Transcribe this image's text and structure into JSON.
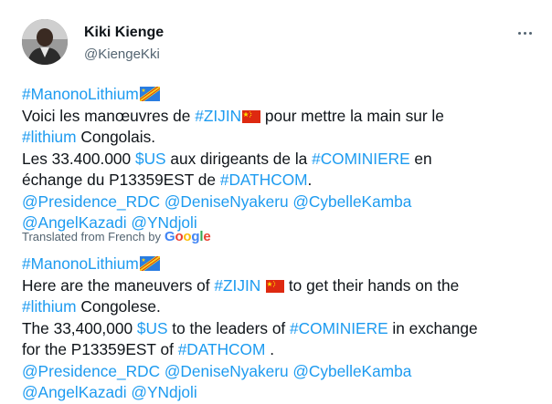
{
  "author": {
    "name": "Kiki Kienge",
    "handle": "@KiengeKki"
  },
  "original": {
    "line1": {
      "hashtag": "#ManonoLithium"
    },
    "line2": {
      "pre": "Voici les manœuvres de ",
      "hashtag": "#ZIJIN",
      "post": " pour mettre la main sur le"
    },
    "line3": {
      "hashtag": "#lithium",
      "post": " Congolais."
    },
    "line4": {
      "pre": "Les 33.400.000 ",
      "cashtag": "$US",
      "mid": " aux dirigeants de la ",
      "hashtag": "#COMINIERE",
      "post": " en"
    },
    "line5": {
      "pre": "échange du P13359EST de ",
      "hashtag": "#DATHCOM",
      "post": "."
    },
    "line6": {
      "m1": "@Presidence_RDC",
      "m2": "@DeniseNyakeru",
      "m3": "@CybelleKamba"
    },
    "line7": {
      "m1": "@AngelKazadi",
      "m2": "@YNdjoli"
    }
  },
  "translation": {
    "label": "Translated from French by",
    "provider": [
      "G",
      "o",
      "o",
      "g",
      "l",
      "e"
    ]
  },
  "translated": {
    "line1": {
      "hashtag": "#ManonoLithium"
    },
    "line2": {
      "pre": "Here are the maneuvers of ",
      "hashtag": "#ZIJIN",
      "post": " to get their hands on the"
    },
    "line3": {
      "hashtag": "#lithium",
      "post": " Congolese."
    },
    "line4": {
      "pre": "The 33,400,000 ",
      "cashtag": "$US",
      "mid": " to the leaders of ",
      "hashtag": "#COMINIERE",
      "post": " in exchange"
    },
    "line5": {
      "pre": "for the P13359EST of ",
      "hashtag": "#DATHCOM",
      "post": " ."
    },
    "line6": {
      "m1": "@Presidence_RDC",
      "m2": "@DeniseNyakeru",
      "m3": "@CybelleKamba"
    },
    "line7": {
      "m1": "@AngelKazadi",
      "m2": "@YNdjoli"
    }
  },
  "colors": {
    "link": "#1d9bf0",
    "text": "#0f1419",
    "muted": "#536471"
  },
  "icons": {
    "drc_flag": "flag-drc-icon",
    "china_flag": "flag-china-icon",
    "more": "more-icon"
  }
}
